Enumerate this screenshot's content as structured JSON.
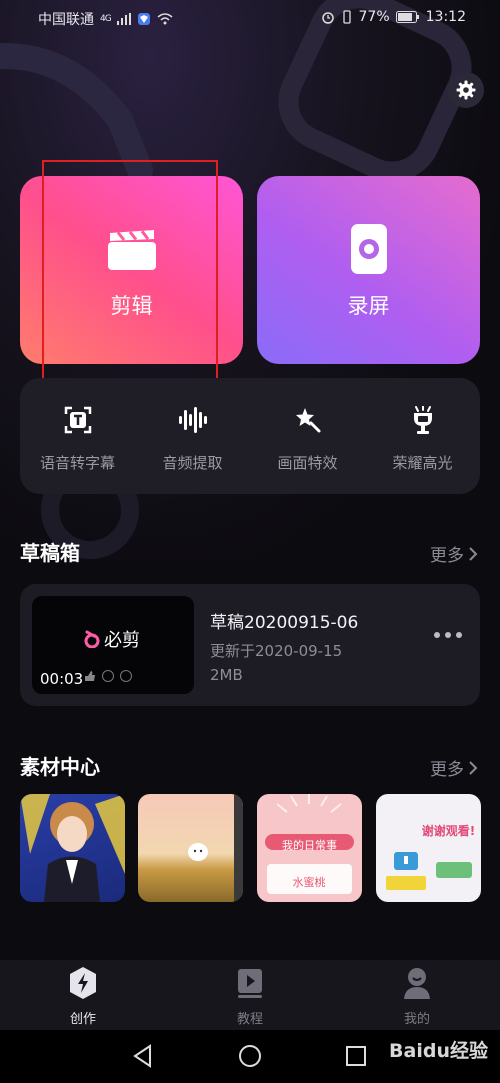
{
  "status_bar": {
    "carrier": "中国联通",
    "network": "4G",
    "battery": "77%",
    "time": "13:12"
  },
  "settings_icon": "gear-icon",
  "hero": {
    "edit_label": "剪辑",
    "record_label": "录屏"
  },
  "tools": [
    {
      "label": "语音转字幕",
      "icon": "caption-icon"
    },
    {
      "label": "音频提取",
      "icon": "waveform-icon"
    },
    {
      "label": "画面特效",
      "icon": "sparkle-icon"
    },
    {
      "label": "荣耀高光",
      "icon": "trophy-icon"
    }
  ],
  "drafts": {
    "title": "草稿箱",
    "more_label": "更多",
    "item": {
      "thumb_brand": "必剪",
      "duration": "00:03",
      "name": "草稿20200915-06",
      "updated": "更新于2020-09-15",
      "size": "2MB"
    }
  },
  "materials": {
    "title": "素材中心",
    "more_label": "更多",
    "items": [
      {
        "caption": ""
      },
      {
        "caption": ""
      },
      {
        "caption": "我的日常事"
      },
      {
        "caption": "谢谢观看!"
      }
    ]
  },
  "tabs": [
    {
      "label": "创作",
      "icon": "bolt-icon",
      "active": true
    },
    {
      "label": "教程",
      "icon": "video-book-icon",
      "active": false
    },
    {
      "label": "我的",
      "icon": "person-icon",
      "active": false
    }
  ],
  "watermark": "Baidu经验"
}
